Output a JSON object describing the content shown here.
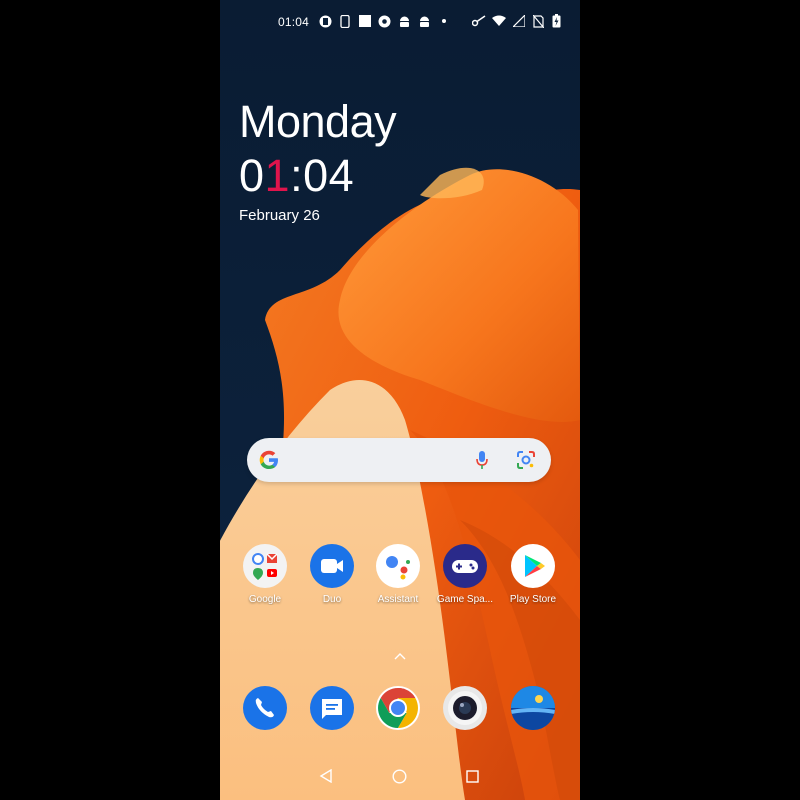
{
  "status_bar": {
    "time": "01:04",
    "icons": [
      "notification-icon",
      "phone-icon",
      "square-icon",
      "chrome-icon",
      "android-icon",
      "android-icon",
      "dot-icon",
      "key-icon",
      "wifi-icon",
      "signal-icon",
      "no-sim-icon",
      "battery-charging-icon"
    ]
  },
  "clock_widget": {
    "day": "Monday",
    "time_part1": "0",
    "time_part2": "1",
    "time_part3": ":04",
    "date": "February 26"
  },
  "search": {
    "icons": [
      "google-icon",
      "microphone-icon",
      "lens-icon"
    ]
  },
  "apps": [
    {
      "label": "Google",
      "icon": "google-folder-icon"
    },
    {
      "label": "Duo",
      "icon": "duo-icon"
    },
    {
      "label": "Assistant",
      "icon": "assistant-icon"
    },
    {
      "label": "Game Spa...",
      "icon": "game-space-icon"
    },
    {
      "label": "Play Store",
      "icon": "play-store-icon"
    }
  ],
  "dock": [
    {
      "icon": "phone-app-icon"
    },
    {
      "icon": "messages-icon"
    },
    {
      "icon": "chrome-app-icon"
    },
    {
      "icon": "camera-icon"
    },
    {
      "icon": "gallery-icon"
    }
  ],
  "nav": [
    "back-icon",
    "home-icon",
    "recents-icon"
  ],
  "colors": {
    "wallpaper_dark": "#0b2038",
    "wallpaper_orange": "#f26a16",
    "wallpaper_peach": "#fbc587",
    "clock_accent": "#e0144c"
  }
}
